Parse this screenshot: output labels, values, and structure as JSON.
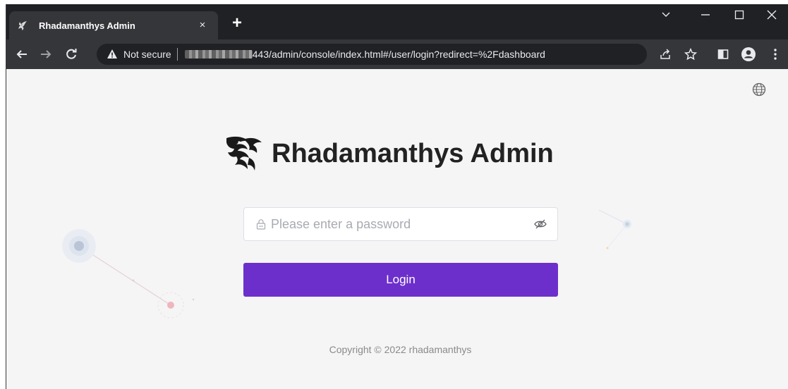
{
  "browser": {
    "tab": {
      "title": "Rhadamanthys Admin",
      "close_glyph": "×",
      "favicon": "dragon-icon"
    },
    "new_tab_glyph": "+",
    "omnibox": {
      "security_label": "Not secure",
      "url_visible": "443/admin/console/index.html#/user/login?redirect=%2Fdashboard"
    },
    "toolbar_icons": [
      "back-arrow-icon",
      "forward-arrow-icon",
      "reload-icon",
      "share-icon",
      "star-icon",
      "side-panel-icon",
      "profile-icon",
      "menu-icon"
    ],
    "window_controls": [
      "chevron-down-icon",
      "minimize-icon",
      "maximize-icon",
      "close-icon"
    ]
  },
  "page": {
    "brand_title": "Rhadamanthys Admin",
    "password": {
      "value": "",
      "placeholder": "Please enter a password"
    },
    "login_label": "Login",
    "copyright": "Copyright © 2022 rhadamanthys",
    "language_icon": "globe-icon"
  },
  "colors": {
    "accent": "#6d2fcc",
    "chrome_dark": "#202124",
    "chrome_toolbar": "#35363a",
    "page_bg": "#f5f5f5"
  }
}
